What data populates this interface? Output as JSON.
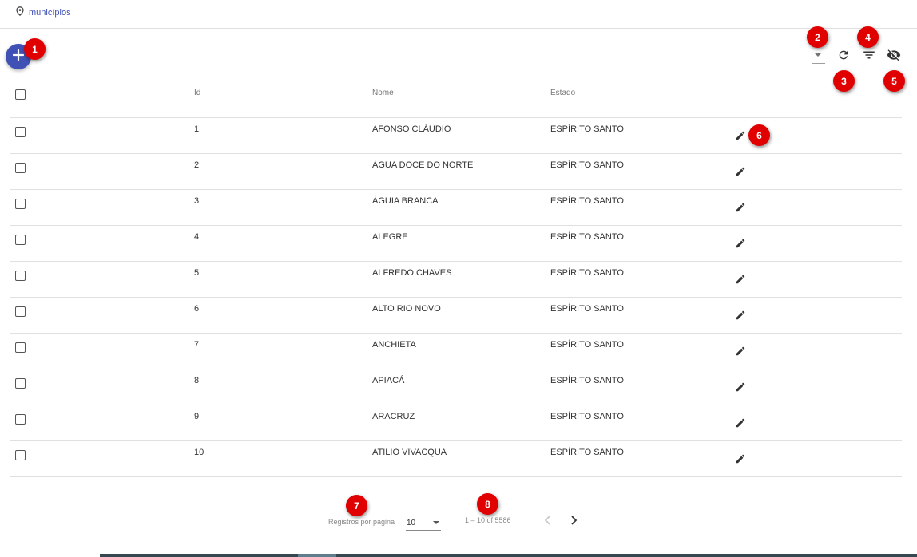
{
  "breadcrumb": {
    "icon": "location-pin-icon",
    "label": "municípios"
  },
  "toolbar": {
    "add_icon": "plus-icon",
    "column_select_icon": "dropdown-arrow-icon",
    "refresh_icon": "refresh-icon",
    "filter_icon": "filter-icon",
    "visibility_icon": "eye-off-icon"
  },
  "table": {
    "headers": {
      "id": "Id",
      "nome": "Nome",
      "estado": "Estado"
    },
    "rows": [
      {
        "id": "1",
        "nome": "AFONSO CLÁUDIO",
        "estado": "ESPÍRITO SANTO"
      },
      {
        "id": "2",
        "nome": "ÁGUA DOCE DO NORTE",
        "estado": "ESPÍRITO SANTO"
      },
      {
        "id": "3",
        "nome": "ÁGUIA BRANCA",
        "estado": "ESPÍRITO SANTO"
      },
      {
        "id": "4",
        "nome": "ALEGRE",
        "estado": "ESPÍRITO SANTO"
      },
      {
        "id": "5",
        "nome": "ALFREDO CHAVES",
        "estado": "ESPÍRITO SANTO"
      },
      {
        "id": "6",
        "nome": "ALTO RIO NOVO",
        "estado": "ESPÍRITO SANTO"
      },
      {
        "id": "7",
        "nome": "ANCHIETA",
        "estado": "ESPÍRITO SANTO"
      },
      {
        "id": "8",
        "nome": "APIACÁ",
        "estado": "ESPÍRITO SANTO"
      },
      {
        "id": "9",
        "nome": "ARACRUZ",
        "estado": "ESPÍRITO SANTO"
      },
      {
        "id": "10",
        "nome": "ATILIO VIVACQUA",
        "estado": "ESPÍRITO SANTO"
      }
    ]
  },
  "pagination": {
    "page_size_label": "Registros por página",
    "page_size_value": "10",
    "range_label": "1 – 10 of 5586"
  },
  "annotations": [
    "1",
    "2",
    "3",
    "4",
    "5",
    "6",
    "7",
    "8"
  ],
  "colors": {
    "primary": "#3f51b5",
    "marker": "#e00000"
  }
}
